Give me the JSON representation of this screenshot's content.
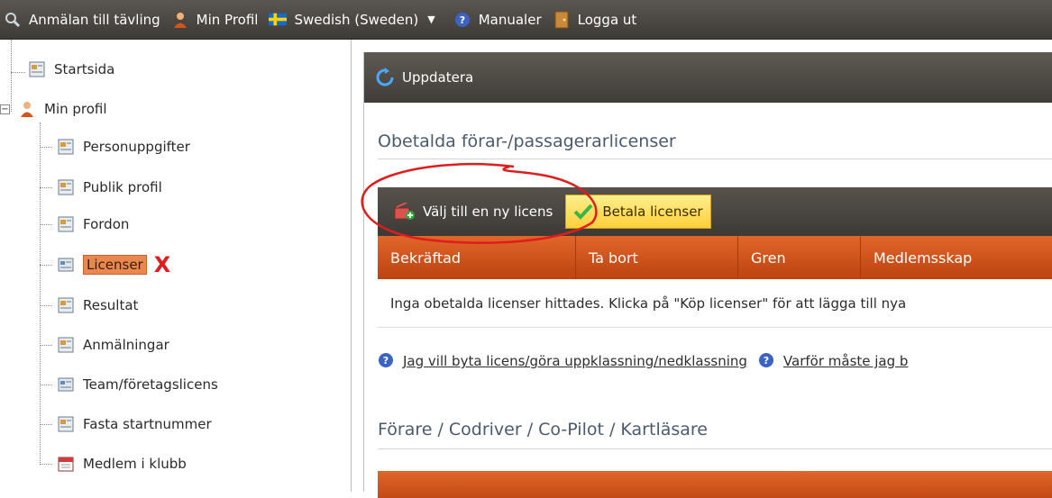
{
  "topbar": {
    "items": [
      {
        "label": "Anmälan till tävling",
        "icon": "search-icon"
      },
      {
        "label": "Min Profil",
        "icon": "user-icon"
      },
      {
        "label": "Swedish (Sweden)",
        "icon": "swedish-flag-icon"
      },
      {
        "label": "Manualer",
        "icon": "help-icon"
      },
      {
        "label": "Logga ut",
        "icon": "door-icon"
      }
    ]
  },
  "tree": {
    "items": [
      {
        "label": "Startsida",
        "icon": "page-icon"
      },
      {
        "label": "Min profil",
        "icon": "user-icon"
      },
      {
        "label": "Personuppgifter",
        "icon": "page-icon"
      },
      {
        "label": "Publik profil",
        "icon": "page-icon"
      },
      {
        "label": "Fordon",
        "icon": "page-icon"
      },
      {
        "label": "Licenser",
        "icon": "form-icon",
        "selected": true
      },
      {
        "label": "Resultat",
        "icon": "page-icon"
      },
      {
        "label": "Anmälningar",
        "icon": "page-icon"
      },
      {
        "label": "Team/företagslicens",
        "icon": "form-icon"
      },
      {
        "label": "Fasta startnummer",
        "icon": "page-icon"
      },
      {
        "label": "Medlem i klubb",
        "icon": "calendar-icon"
      }
    ],
    "marker": "X"
  },
  "panel": {
    "refresh_label": "Uppdatera",
    "section1_title": "Obetalda förar-/passagerarlicenser",
    "toolbar": {
      "new_license_label": "Välj till en ny licens",
      "pay_label": "Betala licenser"
    },
    "table_headers": [
      "Bekräftad",
      "Ta bort",
      "Gren",
      "Medlemsskap"
    ],
    "empty_message": "Inga obetalda licenser hittades. Klicka på \"Köp licenser\" för att lägga till nya",
    "links": [
      "Jag vill byta licens/göra uppklassning/nedklassning",
      "Varför måste jag b"
    ],
    "section2_title": "Förare / Codriver / Co-Pilot / Kartläsare"
  },
  "colors": {
    "accent_orange": "#d4551c",
    "annotation_red": "#e01d1d",
    "selection": "#e9874f"
  }
}
